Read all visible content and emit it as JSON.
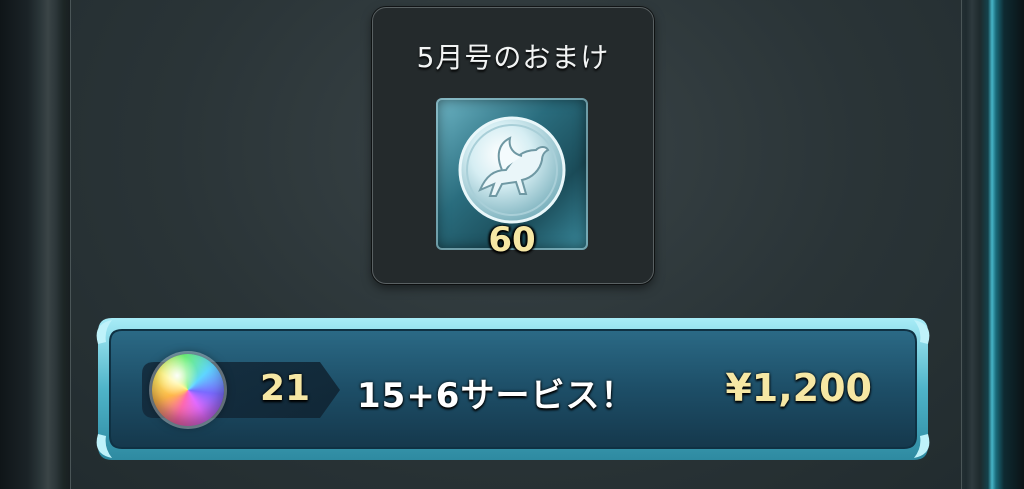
{
  "bonus": {
    "title": "5月号のおまけ",
    "item_icon": "pegasus-coin-icon",
    "item_count": "60"
  },
  "purchase": {
    "orb_icon": "rainbow-orb-icon",
    "orb_count": "21",
    "description": "15+6サービス！",
    "price": "¥1,200"
  },
  "colors": {
    "accent_teal": "#4fb4c9",
    "gold_text": "#f6e7a4",
    "card_bg": "#242a2c"
  }
}
